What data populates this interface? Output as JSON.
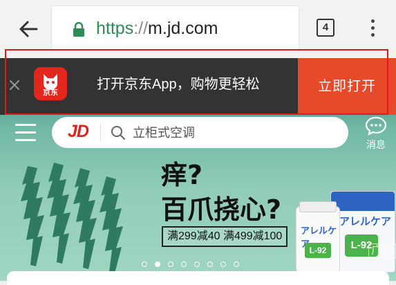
{
  "browser": {
    "url_scheme": "https",
    "url_separator": "://",
    "url_host": "m.jd.com",
    "tab_count": "4"
  },
  "banner": {
    "app_icon_label": "京东",
    "text": "打开京东App，购物更轻松",
    "open_button": "立即打开"
  },
  "header": {
    "logo": "JD",
    "search_placeholder": "立柜式空调",
    "messages_label": "消息"
  },
  "promo": {
    "title_line1": "痒?",
    "title_line2": "百爪挠心?",
    "tag": "满299减40  满499减100",
    "product_brand": "アレルケア",
    "product_badge": "L-92",
    "carousel_count": 8,
    "carousel_active": 2,
    "ad_label": "广告"
  },
  "colors": {
    "jd_red": "#e2231a",
    "open_button": "#e64a2a",
    "banner_bg": "#333333",
    "url_scheme": "#2e8b57"
  }
}
